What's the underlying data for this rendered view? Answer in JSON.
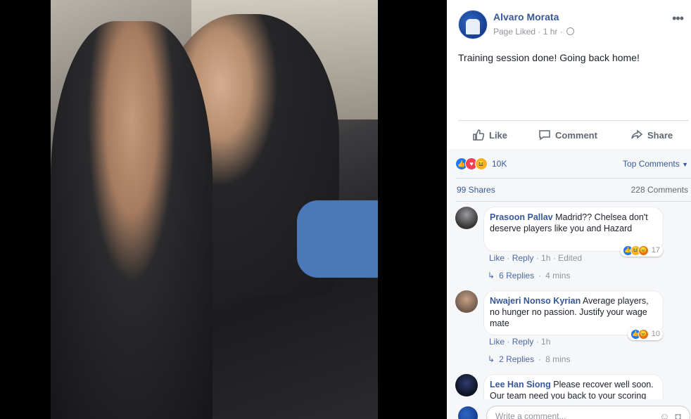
{
  "post": {
    "author": "Alvaro Morata",
    "meta": "Page Liked · 1 hr ·",
    "text": "Training session done! Going back home!",
    "more_icon": "more-dots-icon"
  },
  "actions": {
    "like": "Like",
    "comment": "Comment",
    "share": "Share"
  },
  "stats": {
    "reaction_count": "10K",
    "top_comments": "Top Comments",
    "shares": "99 Shares",
    "comments": "228 Comments"
  },
  "comments": [
    {
      "name": "Prasoon Pallav",
      "text": " Madrid?? Chelsea don't deserve players like you and Hazard",
      "like": "Like",
      "reply": "Reply",
      "time": "1h · Edited",
      "reaction_count": "17",
      "replies": "6 Replies",
      "replies_time": "4 mins"
    },
    {
      "name": "Nwajeri Nonso Kyrian",
      "text": " Average players, no hunger no passion. Justify your wage mate",
      "like": "Like",
      "reply": "Reply",
      "time": "1h",
      "reaction_count": "10",
      "replies": "2 Replies",
      "replies_time": "8 mins"
    },
    {
      "name": "Lee Han Siong",
      "text": " Please recover well soon. Our team need you back to your scoring"
    }
  ],
  "composer": {
    "placeholder": "Write a comment..."
  },
  "colors": {
    "link": "#365899",
    "like_reaction": "#2078f4",
    "love_reaction": "#f33e58",
    "haha_reaction": "#f7b125",
    "angry_reaction": "#e9710f"
  }
}
